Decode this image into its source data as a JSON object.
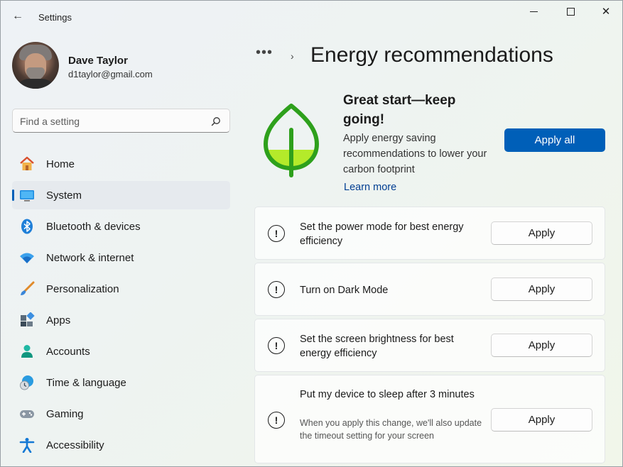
{
  "window": {
    "title": "Settings",
    "back_icon": "←",
    "close_icon": "✕"
  },
  "profile": {
    "name": "Dave Taylor",
    "email": "d1taylor@gmail.com"
  },
  "search": {
    "placeholder": "Find a setting"
  },
  "sidebar": {
    "items": [
      {
        "label": "Home",
        "icon": "home-icon",
        "active": false
      },
      {
        "label": "System",
        "icon": "system-icon",
        "active": true
      },
      {
        "label": "Bluetooth & devices",
        "icon": "bluetooth-icon",
        "active": false
      },
      {
        "label": "Network & internet",
        "icon": "wifi-icon",
        "active": false
      },
      {
        "label": "Personalization",
        "icon": "brush-icon",
        "active": false
      },
      {
        "label": "Apps",
        "icon": "apps-icon",
        "active": false
      },
      {
        "label": "Accounts",
        "icon": "account-icon",
        "active": false
      },
      {
        "label": "Time & language",
        "icon": "clock-globe-icon",
        "active": false
      },
      {
        "label": "Gaming",
        "icon": "gamepad-icon",
        "active": false
      },
      {
        "label": "Accessibility",
        "icon": "accessibility-icon",
        "active": false
      }
    ]
  },
  "breadcrumb": {
    "more": "•••",
    "separator": "›",
    "title": "Energy recommendations"
  },
  "hero": {
    "title": "Great start—keep going!",
    "description": "Apply energy saving recommendations to lower your carbon footprint",
    "link": "Learn more",
    "apply_all_label": "Apply all"
  },
  "recommendations": [
    {
      "title": "Set the power mode for best energy efficiency",
      "subtitle": "",
      "button": "Apply",
      "icon_glyph": "!"
    },
    {
      "title": "Turn on Dark Mode",
      "subtitle": "",
      "button": "Apply",
      "icon_glyph": "!"
    },
    {
      "title": "Set the screen brightness for best energy efficiency",
      "subtitle": "",
      "button": "Apply",
      "icon_glyph": "!"
    },
    {
      "title": "Put my device to sleep after 3 minutes",
      "subtitle": "When you apply this change, we'll also update the timeout setting for your screen",
      "button": "Apply",
      "icon_glyph": "!"
    }
  ],
  "colors": {
    "accent": "#005fb8",
    "leaf_green": "#2ea01c",
    "leaf_light": "#aee81e",
    "link": "#003e92"
  }
}
